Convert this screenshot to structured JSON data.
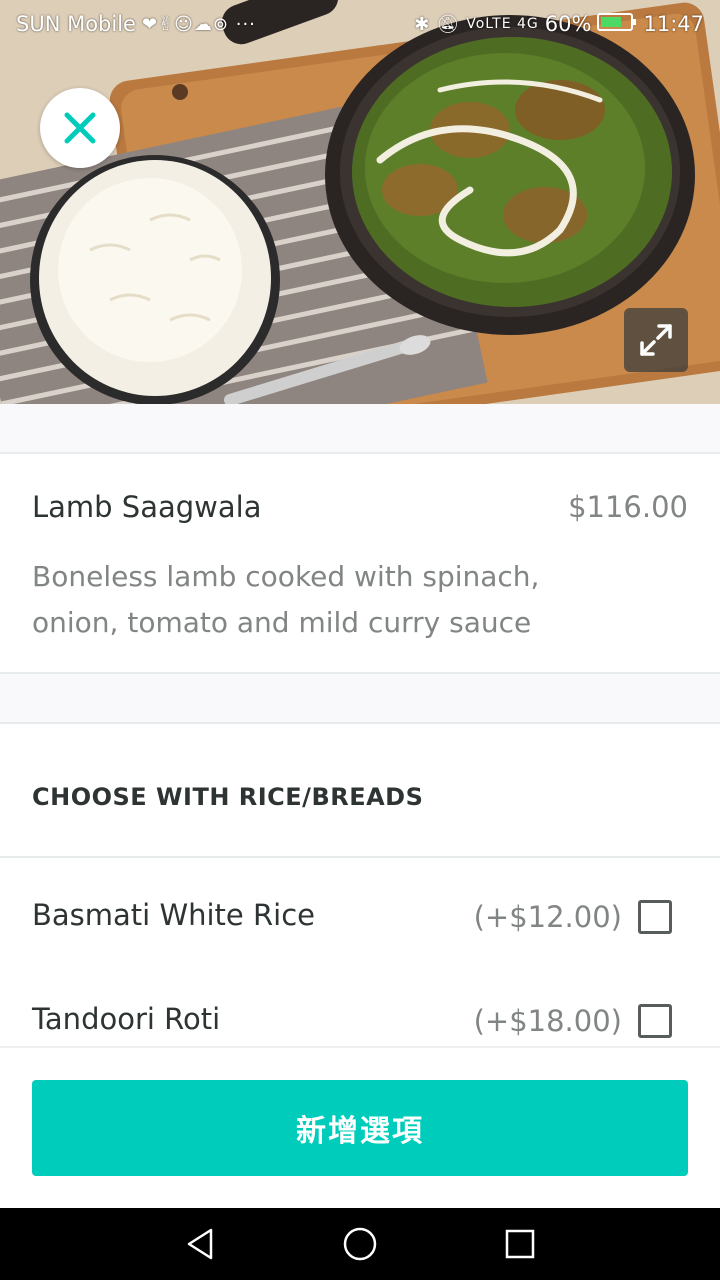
{
  "status_bar": {
    "carrier": "SUN Mobile",
    "notification_icons": "❤✌☺☁⊚ ···",
    "network": "VoLTE 4G",
    "battery_percent": "60%",
    "time": "11:47"
  },
  "hero": {
    "close_icon": "close-icon",
    "expand_icon": "expand-icon"
  },
  "item": {
    "name": "Lamb Saagwala",
    "price": "$116.00",
    "description": "Boneless lamb cooked with spinach, onion, tomato and mild curry sauce"
  },
  "section": {
    "title": "CHOOSE WITH RICE/BREADS"
  },
  "options": [
    {
      "label": "Basmati White Rice",
      "price": "(+$12.00)",
      "checked": false
    },
    {
      "label": "Tandoori Roti",
      "price": "(+$18.00)",
      "checked": false
    }
  ],
  "footer": {
    "add_button_label": "新增選項"
  },
  "colors": {
    "accent": "#00ccbc",
    "text_primary": "#2e3333",
    "text_secondary": "#828585"
  }
}
